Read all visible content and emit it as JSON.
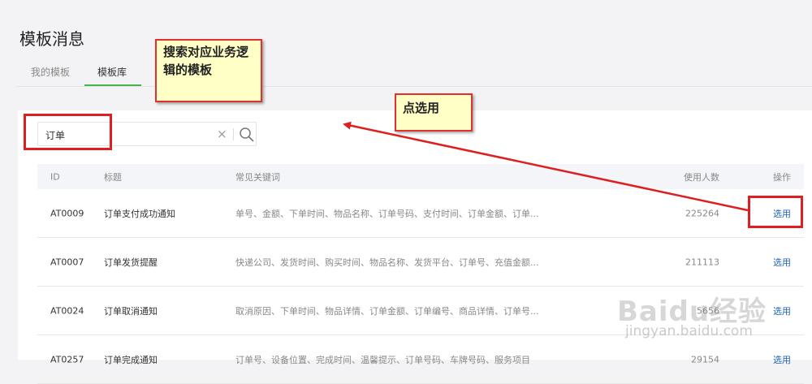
{
  "page": {
    "title": "模板消息"
  },
  "tabs": [
    {
      "label": "我的模板"
    },
    {
      "label": "模板库",
      "active": true
    }
  ],
  "search": {
    "value": "订单",
    "placeholder": ""
  },
  "table": {
    "headers": {
      "id": "ID",
      "title": "标题",
      "keywords": "常见关键词",
      "count": "使用人数",
      "op": "操作"
    },
    "rows": [
      {
        "id": "AT0009",
        "title": "订单支付成功通知",
        "keywords": "单号、金额、下单时间、物品名称、订单号码、支付时间、订单金额、订单...",
        "count": "225264",
        "op": "选用"
      },
      {
        "id": "AT0007",
        "title": "订单发货提醒",
        "keywords": "快递公司、发货时间、购买时间、物品名称、发货平台、订单号、充值金额...",
        "count": "211113",
        "op": "选用"
      },
      {
        "id": "AT0024",
        "title": "订单取消通知",
        "keywords": "取消原因、下单时间、物品详情、订单金额、订单编号、商品详情、订单号...",
        "count": "5656",
        "op": "选用"
      },
      {
        "id": "AT0257",
        "title": "订单完成通知",
        "keywords": "订单号、设备位置、完成时间、温馨提示、订单号码、车牌号码、服务项目",
        "count": "29154",
        "op": "选用"
      }
    ]
  },
  "annotations": {
    "callout_search": "搜索对应业务逻辑的模板",
    "callout_select": "点选用"
  },
  "watermark": {
    "brand": "Baidu经验",
    "url": "jingyan.baidu.com"
  },
  "colors": {
    "accent_green": "#44b549",
    "link_blue": "#1e64b4",
    "annotation_red": "#dd1f1f",
    "callout_bg": "#ffffc6"
  }
}
